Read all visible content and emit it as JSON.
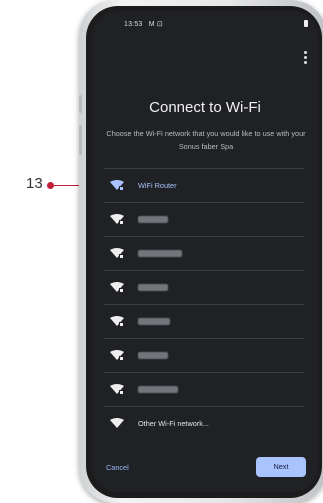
{
  "callout": {
    "number": "13"
  },
  "status_bar": {
    "time": "13:53",
    "indicators": "M ⊡"
  },
  "header": {
    "title": "Connect to Wi-Fi",
    "subtitle": "Choose the Wi-Fi network that you would like to use with your Sonus faber Spa"
  },
  "networks": [
    {
      "label": "WiFi Router",
      "selected": true
    },
    {
      "label": "",
      "blurred": true
    },
    {
      "label": "",
      "blurred": true
    },
    {
      "label": "",
      "blurred": true
    },
    {
      "label": "",
      "blurred": true
    },
    {
      "label": "",
      "blurred": true
    },
    {
      "label": "",
      "blurred": true
    },
    {
      "label": "Other Wi-Fi network..."
    }
  ],
  "footer": {
    "cancel_label": "Cancel",
    "next_label": "Next"
  },
  "colors": {
    "screen_bg": "#1f2124",
    "accent": "#a9c3ff",
    "callout": "#c0203a"
  }
}
